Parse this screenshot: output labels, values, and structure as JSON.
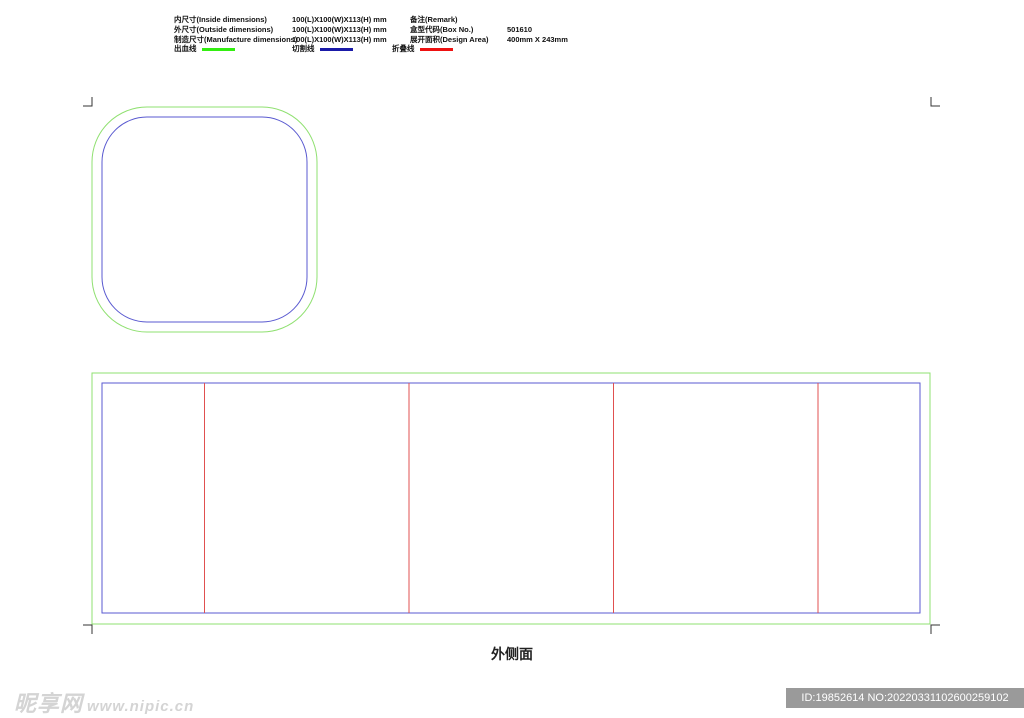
{
  "spec": {
    "rows": [
      {
        "label": "内尺寸(Inside dimensions)",
        "value": "100(L)X100(W)X113(H) mm",
        "label2": "备注(Remark)",
        "value2": ""
      },
      {
        "label": "外尺寸(Outside dimensions)",
        "value": "100(L)X100(W)X113(H) mm",
        "label2": "盒型代码(Box No.)",
        "value2": "501610"
      },
      {
        "label": "制造尺寸(Manufacture dimensions)",
        "value": "100(L)X100(W)X113(H) mm",
        "label2": "展开面积(Design Area)",
        "value2": "400mm X 243mm"
      }
    ],
    "legend": [
      {
        "label": "出血线",
        "color": "#33ee11"
      },
      {
        "label": "切割线",
        "color": "#1a1aa8"
      },
      {
        "label": "折叠线",
        "color": "#ee1111"
      }
    ]
  },
  "colors": {
    "bleed": "#8fe070",
    "cut": "#5a5ad0",
    "fold": "#e05050",
    "crop": "#333333"
  },
  "caption": "外侧面",
  "watermark": {
    "left_cn": "昵享网",
    "left_url": "www.nipic.cn",
    "right": "ID:19852614 NO:20220331102600259102"
  }
}
